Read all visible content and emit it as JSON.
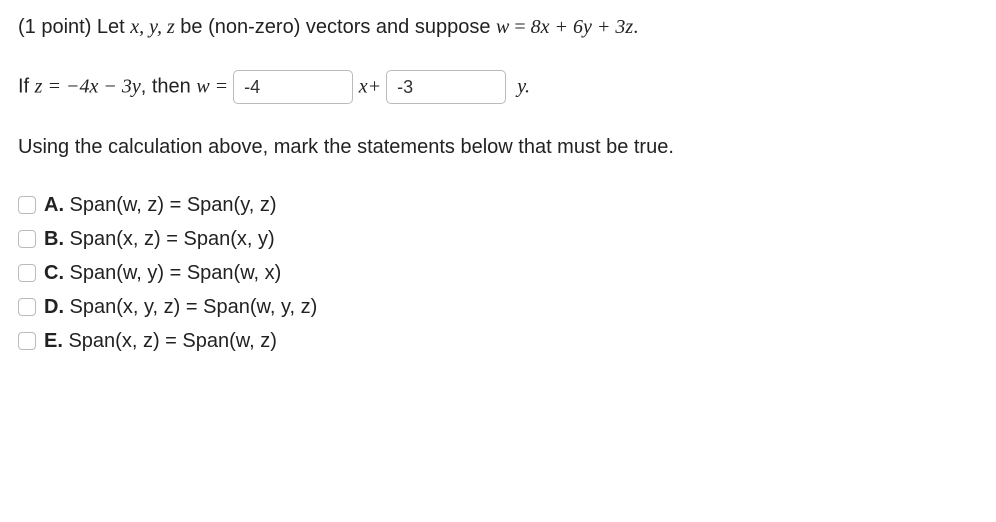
{
  "prompt": {
    "prefix": "(1 point) Let ",
    "vars_xyz": "x, y, z",
    "mid1": " be (non-zero) vectors and suppose ",
    "eq_lhs": "w",
    "eq_eq": " = ",
    "eq_rhs": "8x + 6y + 3z",
    "dot": "."
  },
  "line2": {
    "if_txt": "If ",
    "z_eq": "z = −4x − 3y",
    "then_txt": ", then ",
    "w_eq": "w = ",
    "input1_value": "-4",
    "xplus": "x+ ",
    "input2_value": "-3",
    "y_dot": "y."
  },
  "instruction": "Using the calculation above, mark the statements below that must be true.",
  "options": [
    {
      "letter": "A.",
      "text": " Span(w, z) = Span(y, z)"
    },
    {
      "letter": "B.",
      "text": " Span(x, z) = Span(x, y)"
    },
    {
      "letter": "C.",
      "text": " Span(w, y) = Span(w, x)"
    },
    {
      "letter": "D.",
      "text": " Span(x, y, z) = Span(w, y, z)"
    },
    {
      "letter": "E.",
      "text": " Span(x, z) = Span(w, z)"
    }
  ]
}
